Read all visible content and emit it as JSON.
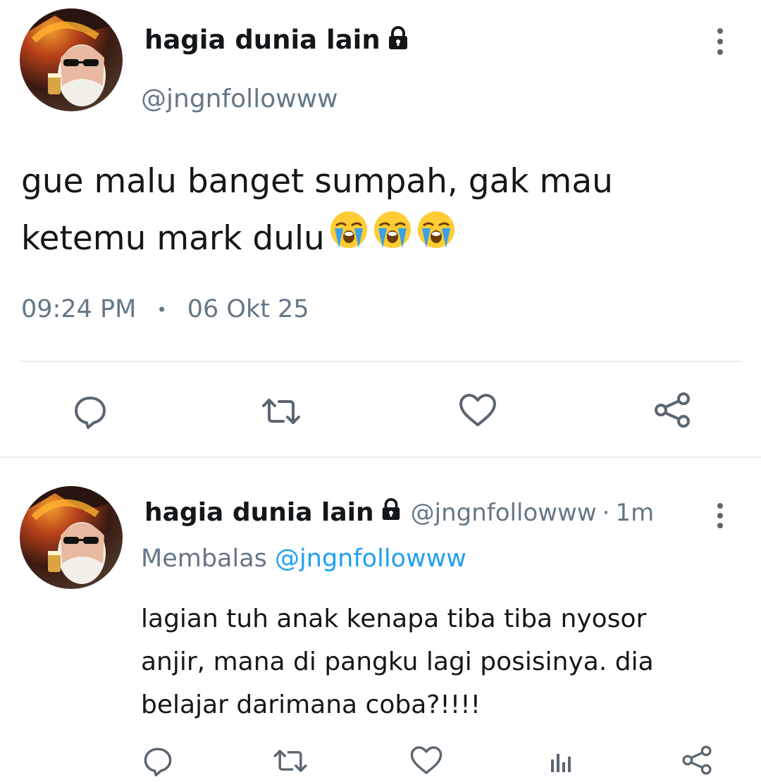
{
  "main_tweet": {
    "author_name": "hagia dunia lain",
    "author_handle": "@jngnfollowww",
    "text_line1": "gue malu banget sumpah, gak mau",
    "text_line2": "ketemu mark dulu",
    "emojis": [
      "loudly-crying-face-icon",
      "loudly-crying-face-icon",
      "loudly-crying-face-icon"
    ],
    "time": "09:24 PM",
    "separator": "•",
    "date": "06 Okt 25"
  },
  "reply_tweet": {
    "author_name": "hagia dunia lain",
    "author_handle": "@jngnfollowww",
    "dot": "·",
    "age": "1m",
    "replying_prefix": "Membalas",
    "replying_to": "@jngnfollowww",
    "text_line1": "lagian tuh anak kenapa tiba tiba nyosor",
    "text_line2": "anjir, mana di pangku lagi posisinya. dia",
    "text_line3": "belajar darimana coba?!!!!"
  },
  "colors": {
    "text": "#14171a",
    "muted": "#657786",
    "link": "#1da1f2",
    "icon": "#5b6670",
    "divider": "#e6ecf0"
  }
}
